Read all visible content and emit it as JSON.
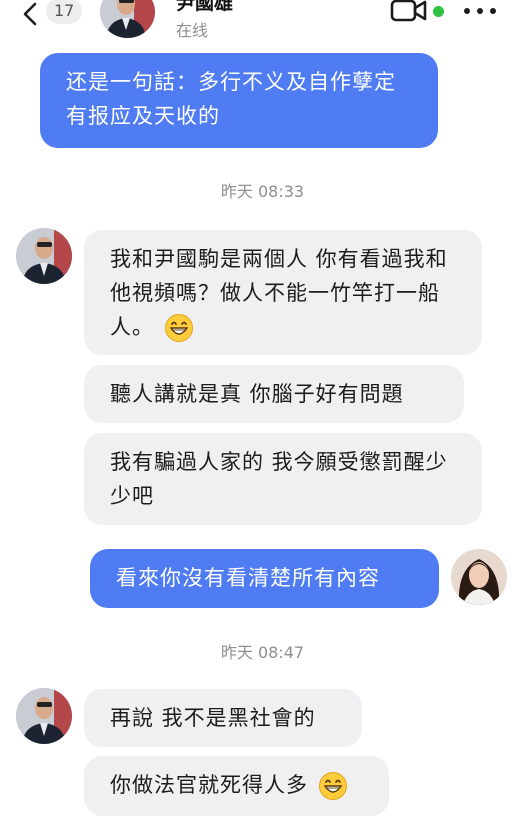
{
  "header": {
    "back_count": "17",
    "contact_name": "尹國雄",
    "status": "在线"
  },
  "messages": {
    "m1": "还是一句話：多行不义及自作孽定有报应及天收的",
    "ts1": "昨天 08:33",
    "m2": "我和尹國駒是兩個人 你有看過我和他視頻嗎？做人不能一竹竿打一船人。",
    "m3": "聽人講就是真 你腦子好有問題",
    "m4": "我有騙過人家的 我今願受懲罰醒少少吧",
    "m5": "看來你沒有看清楚所有內容",
    "ts2": "昨天 08:47",
    "m6": "再說 我不是黑社會的",
    "m7": "你做法官就死得人多"
  },
  "colors": {
    "outgoing_bubble": "#4f7cf3",
    "incoming_bubble": "#f0f0f2",
    "online_dot": "#2ec23f"
  },
  "icons": [
    "back-chevron-icon",
    "video-camera-icon",
    "more-dots-icon",
    "grinning-emoji-icon"
  ]
}
